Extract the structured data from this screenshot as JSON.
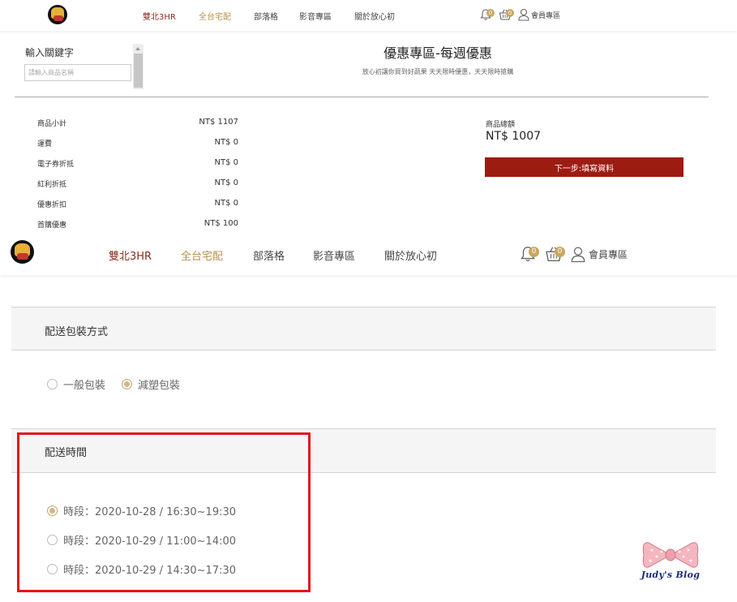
{
  "nav": {
    "items": [
      {
        "label": "雙北3HR",
        "color": "#8b2a1d"
      },
      {
        "label": "全台宅配",
        "color": "#b8914e"
      },
      {
        "label": "部落格",
        "color": "#444444"
      },
      {
        "label": "影音專區",
        "color": "#444444"
      },
      {
        "label": "關於放心初",
        "color": "#444444"
      }
    ],
    "notify_count": "0",
    "cart_count": "0",
    "member_label": "會員專區"
  },
  "search": {
    "title": "輸入關鍵字",
    "placeholder": "請輸入商品名稱"
  },
  "promo": {
    "title": "優惠專區-每週優惠",
    "subtitle": "放心初讓你買到好蔬果 天天限時優惠，天天限時搶購"
  },
  "summary": {
    "rows": [
      {
        "label": "商品小計",
        "value": "NT$ 1107"
      },
      {
        "label": "運費",
        "value": "NT$ 0"
      },
      {
        "label": "電子券折抵",
        "value": "NT$ 0"
      },
      {
        "label": "紅利折抵",
        "value": "NT$ 0"
      },
      {
        "label": "優惠折扣",
        "value": "NT$ 0"
      },
      {
        "label": "首購優惠",
        "value": "NT$ 100"
      }
    ],
    "total_label": "商品總額",
    "total_value": "NT$ 1007",
    "next_button": "下一步:填寫資料"
  },
  "packaging": {
    "title": "配送包裝方式",
    "options": [
      {
        "label": "一般包裝",
        "checked": false
      },
      {
        "label": "減塑包裝",
        "checked": true
      }
    ]
  },
  "delivery": {
    "title": "配送時間",
    "options": [
      {
        "label": "時段：2020-10-28 / 16:30~19:30",
        "checked": true
      },
      {
        "label": "時段：2020-10-29 / 11:00~14:00",
        "checked": false
      },
      {
        "label": "時段：2020-10-29 / 14:30~17:30",
        "checked": false
      }
    ]
  },
  "watermark": {
    "text": "Judy's Blog"
  },
  "colors": {
    "brand_dark_red": "#9c1c12",
    "accent_gold": "#c9a660",
    "highlight_red": "#e3151a"
  }
}
